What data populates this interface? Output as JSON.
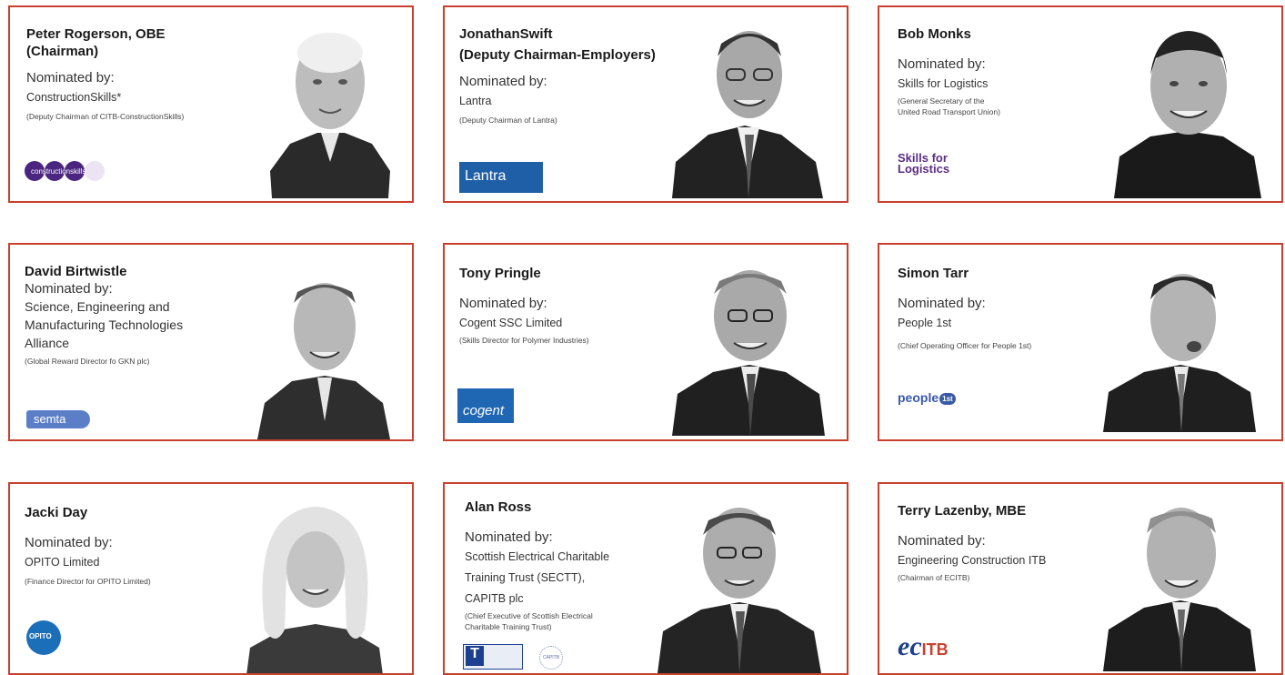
{
  "cards": [
    {
      "name": "Peter Rogerson, OBE",
      "name2": "(Chairman)",
      "nominated": "Nominated by:",
      "org": "ConstructionSkills*",
      "role": "(Deputy Chairman of CITB-ConstructionSkills)",
      "logo": "constructionskills"
    },
    {
      "name": "JonathanSwift",
      "name2": "(Deputy Chairman-Employers)",
      "nominated": "Nominated by:",
      "org": "Lantra",
      "role": "(Deputy Chairman of Lantra)",
      "logo": "Lantra"
    },
    {
      "name": "Bob Monks",
      "nominated": "Nominated by:",
      "org": "Skills for Logistics",
      "role1": "(General Secretary of the",
      "role2": "United Road Transport Union)",
      "logo1": "Skills for",
      "logo2": "Logistics"
    },
    {
      "name": "David Birtwistle",
      "nominated": "Nominated by:",
      "org1": "Science, Engineering and",
      "org2": "Manufacturing Technologies",
      "org3": "Alliance",
      "role": "(Global Reward Director fo GKN plc)",
      "logo": "semta"
    },
    {
      "name": "Tony Pringle",
      "nominated": "Nominated by:",
      "org": "Cogent SSC Limited",
      "role": "(Skills Director for Polymer Industries)",
      "logo": "cogent"
    },
    {
      "name": "Simon Tarr",
      "nominated": "Nominated by:",
      "org": "People 1st",
      "role": "(Chief Operating Officer for People 1st)",
      "logo": "people",
      "logo_badge": "1st"
    },
    {
      "name": "Jacki Day",
      "nominated": "Nominated by:",
      "org": "OPITO Limited",
      "role": "(Finance Director for OPITO Limited)",
      "logo": "OPITO"
    },
    {
      "name": "Alan Ross",
      "nominated": "Nominated by:",
      "org1": "Scottish Electrical Charitable",
      "org2": "Training Trust (SECTT),",
      "org3": "CAPITB plc",
      "role1": "(Chief Executive of Scottish Electrical",
      "role2": "Charitable Training Trust)",
      "logo": "T",
      "logo2": "CAPITB"
    },
    {
      "name": "Terry Lazenby, MBE",
      "nominated": "Nominated by:",
      "org": "Engineering Construction ITB",
      "role": "(Chairman of ECITB)",
      "logo1": "ec",
      "logo2": "ITB"
    }
  ],
  "colors": {
    "border": "#c8402e",
    "cs_purple": "#4b2580",
    "lantra_blue": "#1f5fa8",
    "sfl_purple": "#5a2d82",
    "semta_blue": "#5b7fc7",
    "cogent_blue": "#1f66b3",
    "people_blue": "#3a5aa8",
    "opito_blue": "#1b6fb8",
    "ecitb_blue": "#1d3f8f"
  }
}
